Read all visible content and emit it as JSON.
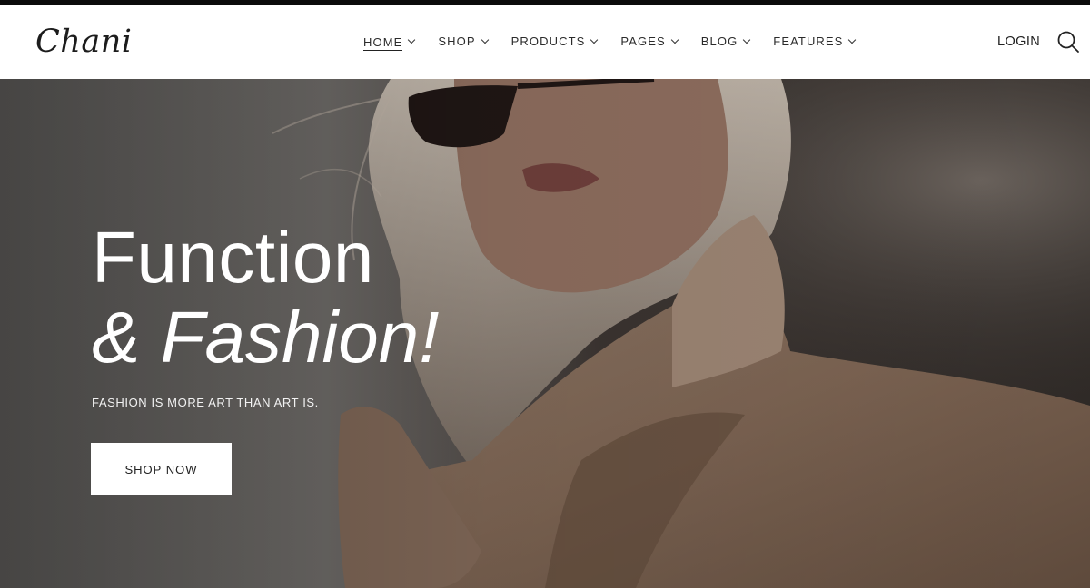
{
  "brand": {
    "logo": "Chani"
  },
  "nav": {
    "items": [
      {
        "label": "HOME",
        "active": true
      },
      {
        "label": "SHOP"
      },
      {
        "label": "PRODUCTS"
      },
      {
        "label": "PAGES"
      },
      {
        "label": "BLOG"
      },
      {
        "label": "FEATURES"
      }
    ],
    "login": "LOGIN"
  },
  "hero": {
    "title_line1": "Function",
    "title_line2": "& Fashion!",
    "subtitle": "FASHION IS MORE ART THAN ART IS.",
    "cta": "SHOP NOW"
  },
  "icons": {
    "search": "search-icon",
    "chevron": "chevron-down-icon"
  }
}
